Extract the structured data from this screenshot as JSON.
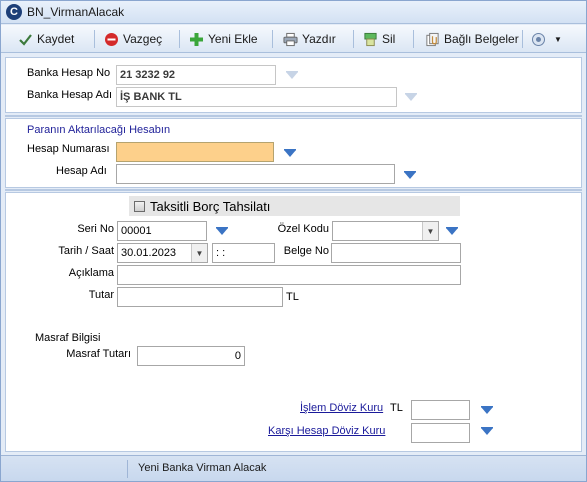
{
  "window": {
    "title": "BN_VirmanAlacak"
  },
  "toolbar": {
    "save": "Kaydet",
    "cancel": "Vazgeç",
    "new": "Yeni Ekle",
    "print": "Yazdır",
    "delete": "Sil",
    "attachments": "Bağlı Belgeler"
  },
  "account": {
    "no_label": "Banka Hesap No",
    "no_value": "21 3232 92",
    "name_label": "Banka Hesap Adı",
    "name_value": "İŞ BANK TL"
  },
  "target": {
    "section_title": "Paranın Aktarılacağı Hesabın",
    "no_label": "Hesap Numarası",
    "no_value": "",
    "name_label": "Hesap Adı",
    "name_value": ""
  },
  "installment": {
    "label": "Taksitli Borç Tahsilatı",
    "checked": false
  },
  "document": {
    "serial_label": "Seri No",
    "serial_value": "00001",
    "special_code_label": "Özel Kodu",
    "special_code_value": "",
    "date_label": "Tarih / Saat",
    "date_value": "30.01.2023",
    "time_value": " : :",
    "doc_no_label": "Belge No",
    "doc_no_value": "",
    "description_label": "Açıklama",
    "description_value": "",
    "amount_label": "Tutar",
    "amount_value": "",
    "amount_currency": "TL"
  },
  "expense": {
    "section_label": "Masraf Bilgisi",
    "amount_label": "Masraf Tutarı",
    "amount_value": "0"
  },
  "fx": {
    "txn_rate_label": "İşlem Döviz Kuru",
    "txn_currency": "TL",
    "txn_rate_value": "",
    "counter_rate_label": "Karşı Hesap Döviz Kuru",
    "counter_rate_value": ""
  },
  "status": {
    "text": "Yeni Banka Virman Alacak"
  },
  "colors": {
    "highlight": "#fdd08b",
    "section_title": "#22239a",
    "accent_arrow": "#3b74c4"
  }
}
